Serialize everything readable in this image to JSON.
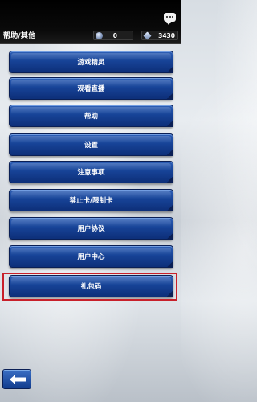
{
  "header": {
    "title": "帮助/其他",
    "gems": "0",
    "dp": "3430",
    "chat_icon": "chat-bubble-icon",
    "gem_icon": "gem-icon",
    "dp_icon": "dp-icon"
  },
  "menu": {
    "items": [
      {
        "label": "游戏精灵"
      },
      {
        "label": "观看直播"
      },
      {
        "label": "帮助"
      },
      {
        "label": "设置"
      },
      {
        "label": "注意事项"
      },
      {
        "label": "禁止卡/限制卡"
      },
      {
        "label": "用户协议"
      },
      {
        "label": "用户中心"
      },
      {
        "label": "礼包码"
      }
    ]
  },
  "footer": {
    "back_icon": "back-arrow-icon"
  },
  "colors": {
    "button_blue": "#174397",
    "highlight_red": "#c8202a",
    "header_black": "#000000"
  }
}
